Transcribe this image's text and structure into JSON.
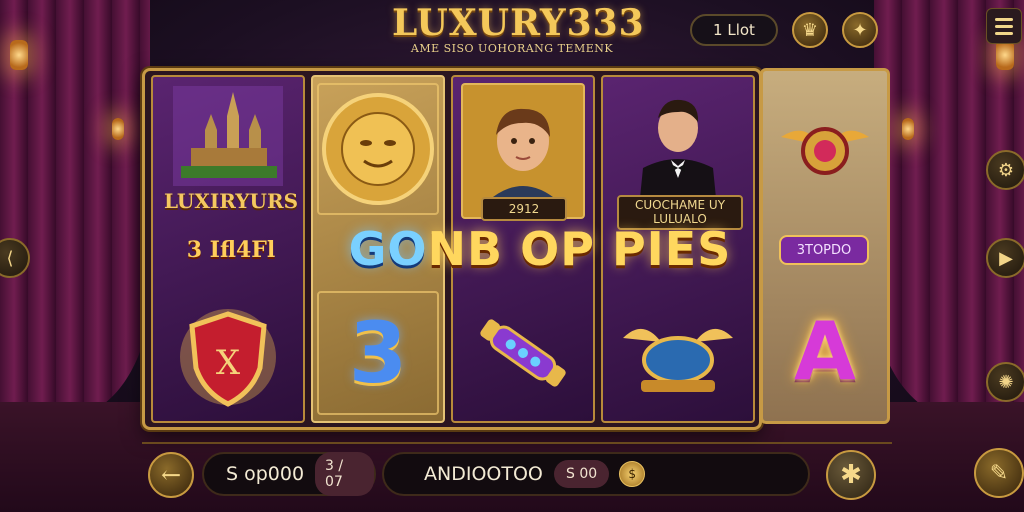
{
  "header": {
    "title": "LUXURY333",
    "subtitle": "AME SISO UOHORANG TEMENK",
    "lot_label": "1 Llot"
  },
  "reels": {
    "reel1": {
      "label": "LUXIRYURS",
      "price": "3 Ifl4Fl"
    },
    "reel3": {
      "plate": "2912"
    },
    "reel4": {
      "plate_line1": "CUOCHAME UY",
      "plate_line2": "LULUALO"
    },
    "reel5": {
      "pill": "3TOPDO"
    }
  },
  "win": {
    "word1_blue": "GO",
    "word1_gold": "NB",
    "word2": "OP",
    "word3": "PIES"
  },
  "bottom": {
    "balance": "S op000",
    "balance_chip": "3 / 07",
    "bet_label": "ANDIOOTOO",
    "bet_chip": "S 00"
  },
  "icons": {
    "back": "arrow-left-icon",
    "spin": "star-icon",
    "menu": "hamburger-icon",
    "crown": "crown-icon",
    "wand": "magic-wand-icon"
  }
}
